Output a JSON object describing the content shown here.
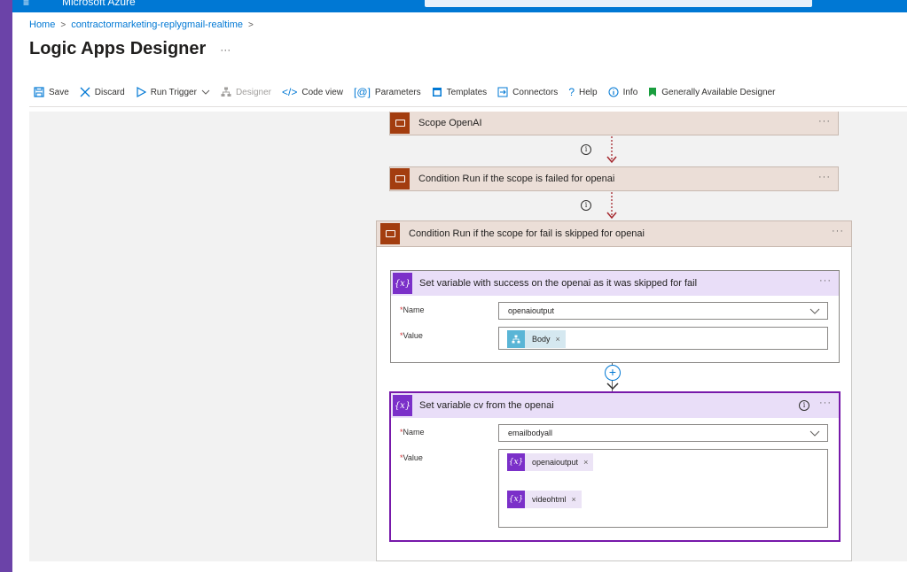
{
  "topbar": {
    "brand": "Microsoft Azure",
    "menu_icon": "hamburger-icon"
  },
  "breadcrumb": {
    "home": "Home",
    "sep": ">",
    "item": "contractormarketing-replygmail-realtime"
  },
  "page": {
    "title": "Logic Apps Designer",
    "more": "···"
  },
  "toolbar": {
    "save": "Save",
    "discard": "Discard",
    "run_trigger": "Run Trigger",
    "designer": "Designer",
    "code_view": "Code view",
    "parameters": "Parameters",
    "templates": "Templates",
    "connectors": "Connectors",
    "help": "Help",
    "info": "Info",
    "ga_designer": "Generally Available Designer"
  },
  "flow": {
    "scope_openai": "Scope OpenAI",
    "condition_failed": "Condition Run if the scope is failed for openai",
    "condition_skipped": "Condition Run if the scope for fail is skipped for openai",
    "more": "···",
    "info_glyph": "i",
    "set_var_1": {
      "title": "Set variable with success on the openai as it was skipped for fail",
      "name_label": "Name",
      "name_value": "openaioutput",
      "value_label": "Value",
      "token_body": "Body"
    },
    "set_var_2": {
      "title": "Set variable cv from the openai",
      "name_label": "Name",
      "name_value": "emailbodyall",
      "value_label": "Value",
      "token_1": "openaioutput",
      "token_2": "videohtml"
    },
    "req_mark": "*",
    "token_remove": "×",
    "var_glyph": "{x}",
    "plus": "+"
  },
  "colors": {
    "azure_blue": "#0078d4",
    "scope_brown": "#a33d0f",
    "variable_purple": "#7b30c9",
    "arrow_red": "#a4262c"
  }
}
